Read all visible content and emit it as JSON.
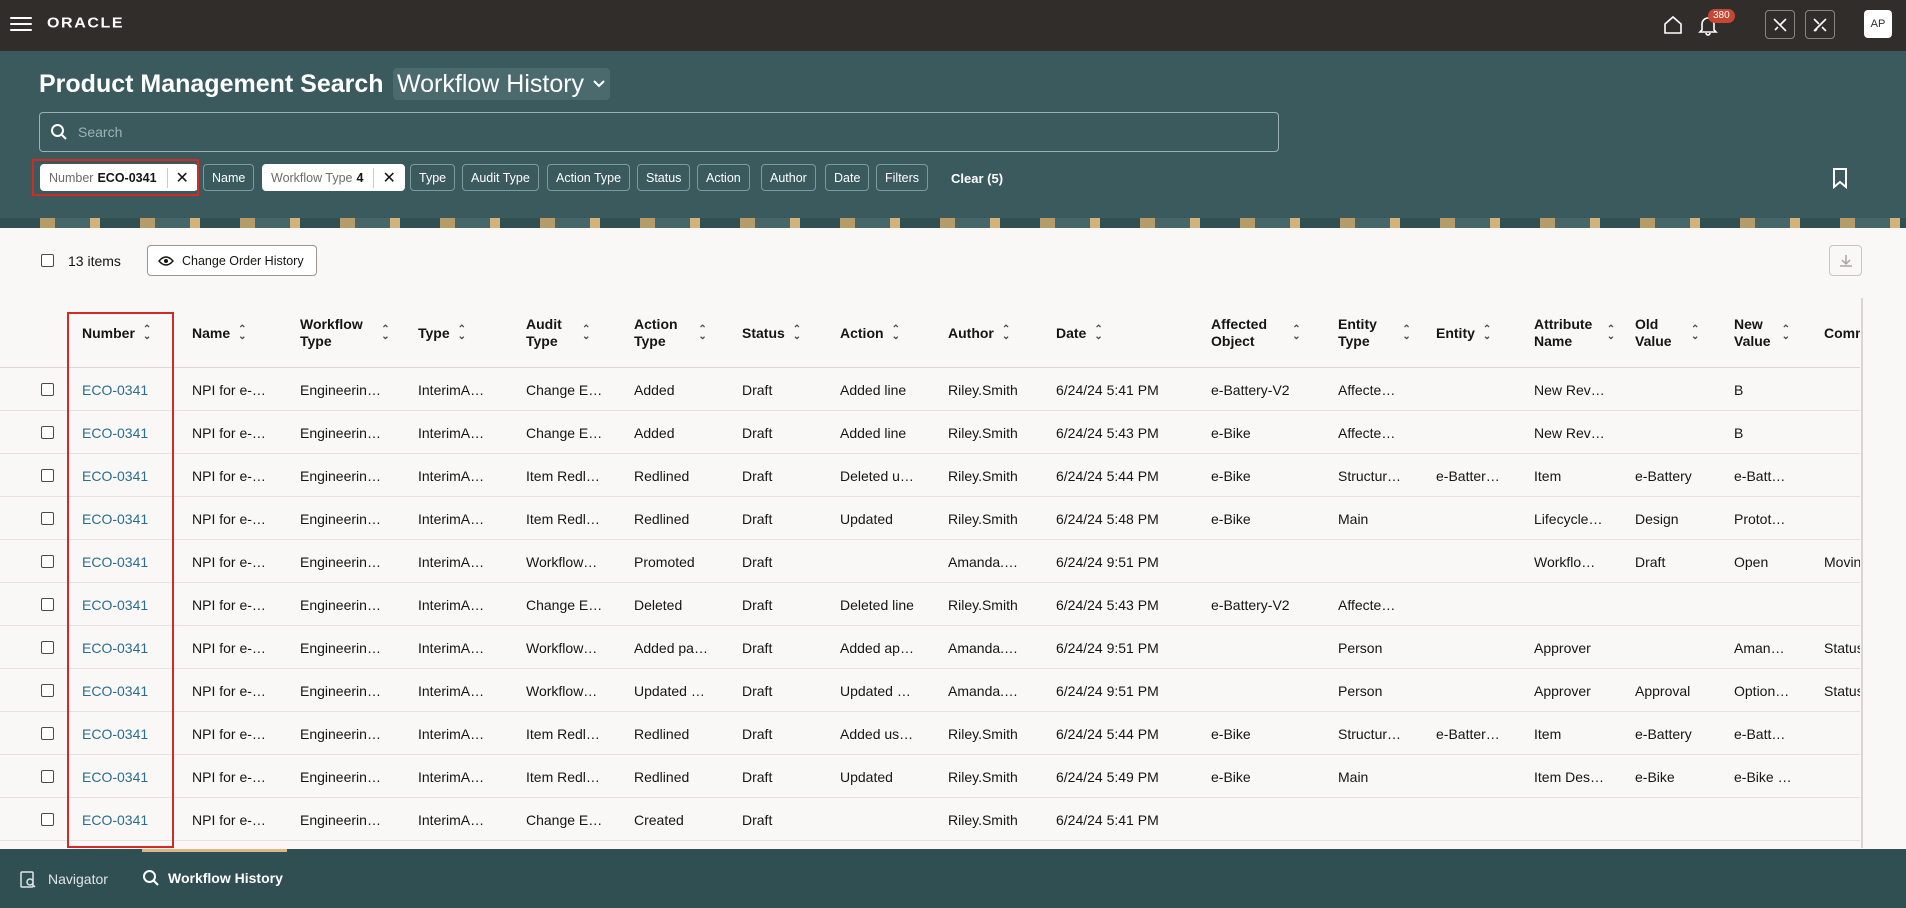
{
  "topbar": {
    "logo": "ORACLE",
    "notification_count": "380",
    "avatar_initials": "AP",
    "icons": [
      "menu-icon",
      "home-icon",
      "bell-icon",
      "tools-icon",
      "no-tools-icon"
    ]
  },
  "header": {
    "title": "Product Management Search",
    "view_selector": "Workflow History",
    "search_placeholder": "Search",
    "chips": [
      {
        "label": "Number",
        "value": "ECO-0341",
        "selected": true
      },
      {
        "label": "Name"
      },
      {
        "label": "Workflow Type",
        "value": "4",
        "selected": true
      },
      {
        "label": "Type"
      },
      {
        "label": "Audit Type"
      },
      {
        "label": "Action Type"
      },
      {
        "label": "Status"
      },
      {
        "label": "Action"
      },
      {
        "label": "Author"
      },
      {
        "label": "Date"
      },
      {
        "label": "Filters"
      }
    ],
    "clear_label": "Clear (5)"
  },
  "toolbar": {
    "items_count": "13 items",
    "change_order_button": "Change Order History"
  },
  "table": {
    "columns": [
      "Number",
      "Name",
      "Workflow Type",
      "Type",
      "Audit Type",
      "Action Type",
      "Status",
      "Action",
      "Author",
      "Date",
      "Affected Object",
      "Entity Type",
      "Entity",
      "Attribute Name",
      "Old Value",
      "New Value",
      "Comment"
    ],
    "rows": [
      [
        "ECO-0341",
        "NPI for e-…",
        "Engineerin…",
        "InterimA…",
        "Change E…",
        "Added",
        "Draft",
        "Added line",
        "Riley.Smith",
        "6/24/24 5:41 PM",
        "e-Battery-V2",
        "Affecte…",
        "",
        "New Rev…",
        "",
        "B",
        ""
      ],
      [
        "ECO-0341",
        "NPI for e-…",
        "Engineerin…",
        "InterimA…",
        "Change E…",
        "Added",
        "Draft",
        "Added line",
        "Riley.Smith",
        "6/24/24 5:43 PM",
        "e-Bike",
        "Affecte…",
        "",
        "New Rev…",
        "",
        "B",
        ""
      ],
      [
        "ECO-0341",
        "NPI for e-…",
        "Engineerin…",
        "InterimA…",
        "Item Redl…",
        "Redlined",
        "Draft",
        "Deleted u…",
        "Riley.Smith",
        "6/24/24 5:44 PM",
        "e-Bike",
        "Structur…",
        "e-Batter…",
        "Item",
        "e-Battery",
        "e-Batt…",
        ""
      ],
      [
        "ECO-0341",
        "NPI for e-…",
        "Engineerin…",
        "InterimA…",
        "Item Redl…",
        "Redlined",
        "Draft",
        "Updated",
        "Riley.Smith",
        "6/24/24 5:48 PM",
        "e-Bike",
        "Main",
        "",
        "Lifecycle…",
        "Design",
        "Protot…",
        ""
      ],
      [
        "ECO-0341",
        "NPI for e-…",
        "Engineerin…",
        "InterimA…",
        "Workflow…",
        "Promoted",
        "Draft",
        "",
        "Amanda.…",
        "6/24/24 9:51 PM",
        "",
        "",
        "",
        "Workflo…",
        "Draft",
        "Open",
        "Movin"
      ],
      [
        "ECO-0341",
        "NPI for e-…",
        "Engineerin…",
        "InterimA…",
        "Change E…",
        "Deleted",
        "Draft",
        "Deleted line",
        "Riley.Smith",
        "6/24/24 5:43 PM",
        "e-Battery-V2",
        "Affecte…",
        "",
        "",
        "",
        "",
        ""
      ],
      [
        "ECO-0341",
        "NPI for e-…",
        "Engineerin…",
        "InterimA…",
        "Workflow…",
        "Added pa…",
        "Draft",
        "Added ap…",
        "Amanda.…",
        "6/24/24 9:51 PM",
        "",
        "Person",
        "",
        "Approver",
        "",
        "Aman…",
        "Status"
      ],
      [
        "ECO-0341",
        "NPI for e-…",
        "Engineerin…",
        "InterimA…",
        "Workflow…",
        "Updated …",
        "Draft",
        "Updated …",
        "Amanda.…",
        "6/24/24 9:51 PM",
        "",
        "Person",
        "",
        "Approver",
        "Approval",
        "Option…",
        "Status"
      ],
      [
        "ECO-0341",
        "NPI for e-…",
        "Engineerin…",
        "InterimA…",
        "Item Redl…",
        "Redlined",
        "Draft",
        "Added us…",
        "Riley.Smith",
        "6/24/24 5:44 PM",
        "e-Bike",
        "Structur…",
        "e-Batter…",
        "Item",
        "e-Battery",
        "e-Batt…",
        ""
      ],
      [
        "ECO-0341",
        "NPI for e-…",
        "Engineerin…",
        "InterimA…",
        "Item Redl…",
        "Redlined",
        "Draft",
        "Updated",
        "Riley.Smith",
        "6/24/24 5:49 PM",
        "e-Bike",
        "Main",
        "",
        "Item Des…",
        "e-Bike",
        "e-Bike …",
        ""
      ],
      [
        "ECO-0341",
        "NPI for e-…",
        "Engineerin…",
        "InterimA…",
        "Change E…",
        "Created",
        "Draft",
        "",
        "Riley.Smith",
        "6/24/24 5:41 PM",
        "",
        "",
        "",
        "",
        "",
        "",
        ""
      ]
    ]
  },
  "footer": {
    "navigator_label": "Navigator",
    "active_tab": "Workflow History"
  },
  "colors": {
    "topbar": "#312d2a",
    "header": "#3a5a5e",
    "link": "#2b6d8c",
    "highlight": "#d02b27"
  }
}
